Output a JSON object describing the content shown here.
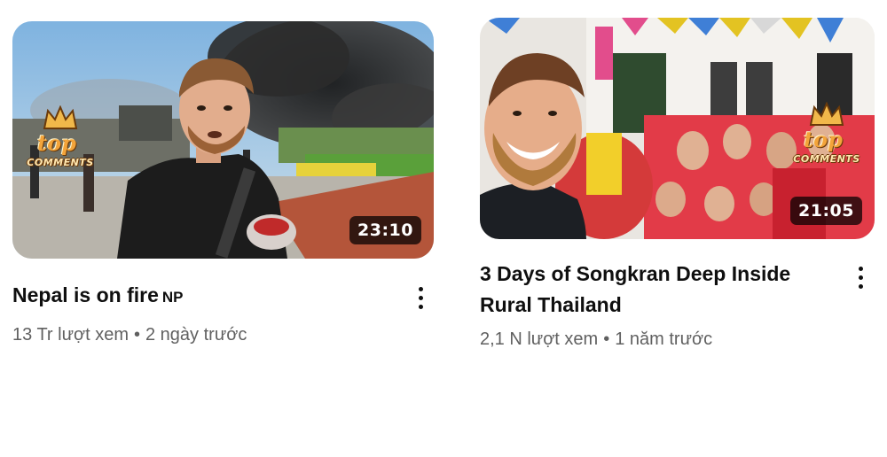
{
  "videos": [
    {
      "title": "Nepal is on fire",
      "country_badge": "NP",
      "duration": "23:10",
      "views": "13 Tr lượt xem",
      "separator": "•",
      "age": "2 ngày trước",
      "watermark_top": "top",
      "watermark_comments": "COMMENTS"
    },
    {
      "title": "3 Days of Songkran Deep Inside Rural Thailand",
      "duration": "21:05",
      "views": "2,1 N lượt xem",
      "separator": "•",
      "age": "1 năm trước",
      "watermark_top": "top",
      "watermark_comments": "COMMENTS"
    }
  ],
  "icons": {
    "more_actions": "vertical-ellipsis"
  }
}
